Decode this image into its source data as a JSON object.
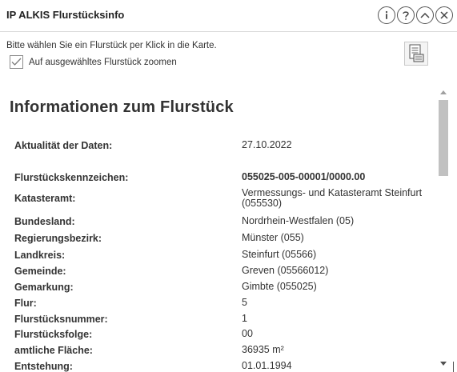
{
  "header": {
    "title": "IP ALKIS Flurstücksinfo",
    "icons": [
      "info-icon",
      "help-icon",
      "collapse-icon",
      "close-icon"
    ]
  },
  "toolbar": {
    "instruction": "Bitte wählen Sie ein Flurstück per Klick in die Karte.",
    "zoom_label": "Auf ausgewähltes Flurstück zoomen",
    "zoom_checked": true,
    "report_icon": "report-document-icon"
  },
  "content": {
    "heading": "Informationen zum Flurstück",
    "rows": [
      {
        "label": "Aktualität der Daten:",
        "value": "27.10.2022"
      },
      {
        "label": "Flurstückskennzeichen:",
        "value": "055025-005-00001/0000.00"
      },
      {
        "label": "Katasteramt:",
        "value": "Vermessungs- und Katasteramt Steinfurt (055530)"
      },
      {
        "label": "Bundesland:",
        "value": "Nordrhein-Westfalen (05)"
      },
      {
        "label": "Regierungsbezirk:",
        "value": "Münster (055)"
      },
      {
        "label": "Landkreis:",
        "value": "Steinfurt (05566)"
      },
      {
        "label": "Gemeinde:",
        "value": "Greven (05566012)"
      },
      {
        "label": "Gemarkung:",
        "value": "Gimbte (055025)"
      },
      {
        "label": "Flur:",
        "value": "5"
      },
      {
        "label": "Flurstücksnummer:",
        "value": "1"
      },
      {
        "label": "Flurstücksfolge:",
        "value": "00"
      },
      {
        "label": "amtliche Fläche:",
        "value": "36935 m²"
      },
      {
        "label": "Entstehung:",
        "value": "01.01.1994"
      }
    ]
  },
  "colors": {
    "text": "#333333",
    "border": "#d9d9d9",
    "scroll_thumb": "#c1c1c1"
  }
}
